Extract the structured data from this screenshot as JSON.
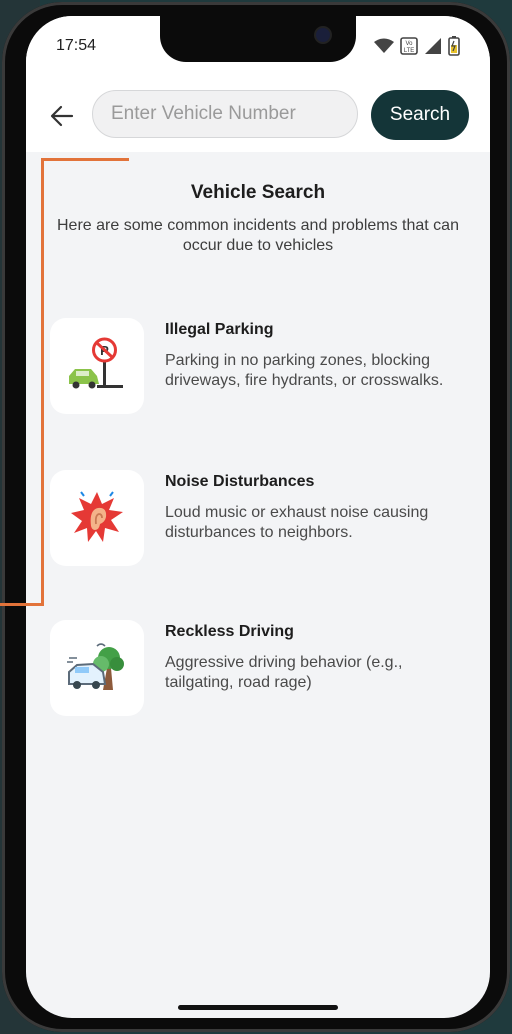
{
  "status": {
    "time": "17:54",
    "icons": [
      "wifi-icon",
      "volte-icon",
      "signal-icon",
      "battery-icon"
    ],
    "volte_label": "Vo LTE"
  },
  "header": {
    "search_placeholder": "Enter Vehicle Number",
    "search_value": "",
    "search_button": "Search"
  },
  "main": {
    "title": "Vehicle Search",
    "subtitle": "Here are some common incidents and problems that can occur due to vehicles",
    "items": [
      {
        "title": "Illegal Parking",
        "description": "Parking in no parking zones, blocking driveways, fire hydrants, or crosswalks.",
        "icon": "no-parking-car-icon"
      },
      {
        "title": "Noise Disturbances",
        "description": "Loud music or exhaust noise causing disturbances to neighbors.",
        "icon": "ear-noise-icon"
      },
      {
        "title": "Reckless Driving",
        "description": "Aggressive driving behavior (e.g., tailgating, road rage)",
        "icon": "car-crash-tree-icon"
      }
    ]
  },
  "colors": {
    "accent": "#143538",
    "highlight": "#e2733a",
    "background": "#f3f4f6"
  }
}
